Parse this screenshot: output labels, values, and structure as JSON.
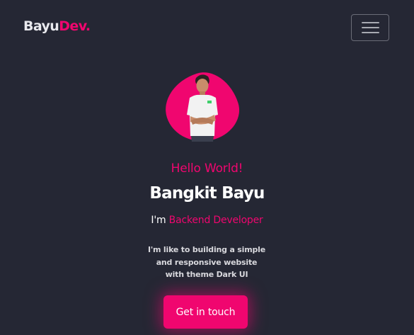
{
  "navbar": {
    "brand_main": "Bayu",
    "brand_accent": "Dev.",
    "menu_icon": "hamburger-menu-icon"
  },
  "hero": {
    "avatar_icon": "profile-photo",
    "greeting": "Hello World!",
    "name": "Bangkit Bayu",
    "role_prefix": "I'm",
    "role_accent": "Backend Developer",
    "description_lines": [
      "I'm like to building a simple",
      "and responsive website",
      "with theme Dark UI"
    ],
    "cta_label": "Get in touch"
  },
  "colors": {
    "background": "#252734",
    "accent": "#f0066f",
    "text": "#ffffff"
  }
}
